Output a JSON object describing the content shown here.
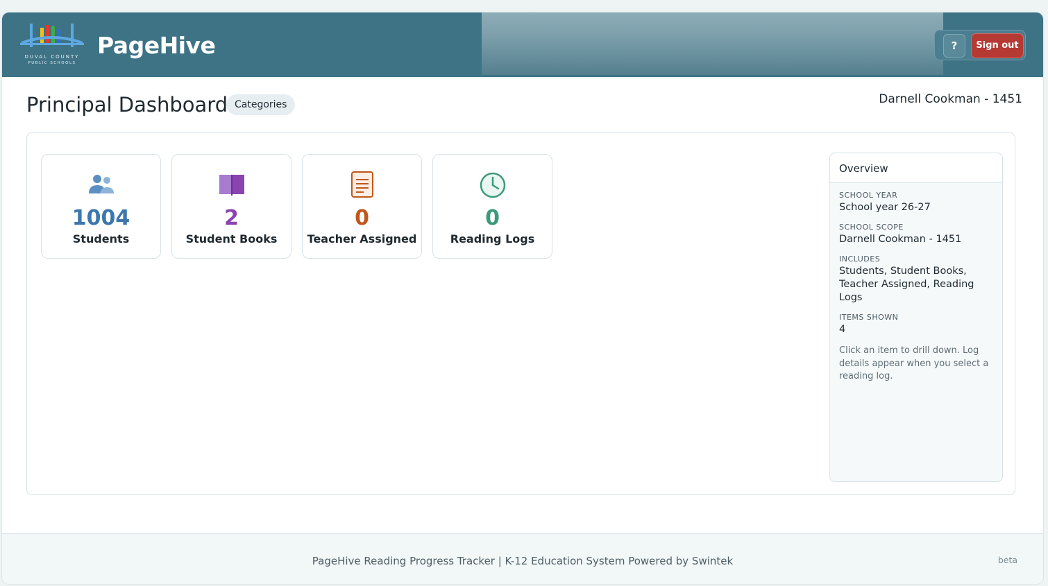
{
  "header": {
    "logo_line1": "DUVAL COUNTY",
    "logo_line2": "PUBLIC SCHOOLS",
    "app_title": "PageHive",
    "help_label": "?",
    "signout_label": "Sign out"
  },
  "page": {
    "title": "Principal Dashboard",
    "categories_label": "Categories",
    "user": "Darnell Cookman - 1451"
  },
  "cards": [
    {
      "count": "1004",
      "label": "Students",
      "icon": "users-icon",
      "color": "#3c77ad"
    },
    {
      "count": "2",
      "label": "Student Books",
      "icon": "book-icon",
      "color": "#8a44b0"
    },
    {
      "count": "0",
      "label": "Teacher Assigned",
      "icon": "document-icon",
      "color": "#c0571a"
    },
    {
      "count": "0",
      "label": "Reading Logs",
      "icon": "clock-icon",
      "color": "#3b9a7b"
    }
  ],
  "overview": {
    "title": "Overview",
    "school_year_key": "SCHOOL YEAR",
    "school_year_val": "School year 26-27",
    "scope_key": "SCHOOL SCOPE",
    "scope_val": "Darnell Cookman - 1451",
    "includes_key": "INCLUDES",
    "includes_val": "Students, Student Books, Teacher Assigned, Reading Logs",
    "items_key": "ITEMS SHOWN",
    "items_val": "4",
    "note": "Click an item to drill down. Log details appear when you select a reading log."
  },
  "footer": {
    "text": "PageHive Reading Progress Tracker | K-12 Education System Powered by Swintek",
    "beta": "beta"
  },
  "colors": {
    "header_bg": "#3e7386",
    "signout_bg": "#b53a33"
  }
}
